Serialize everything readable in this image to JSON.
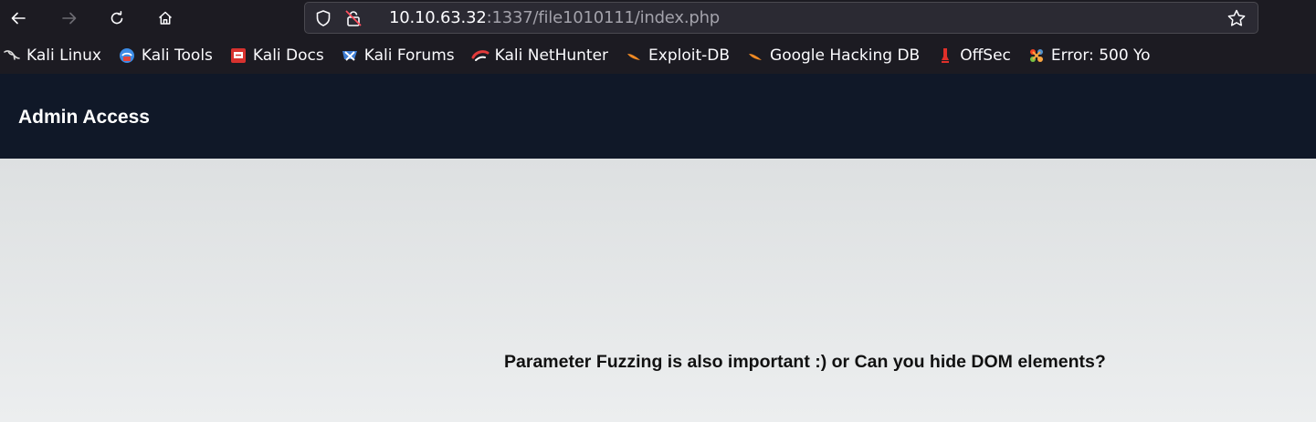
{
  "browser": {
    "url_host": "10.10.63.32",
    "url_rest": ":1337/file1010111/index.php",
    "icons": [
      "back-icon",
      "forward-icon",
      "reload-icon",
      "home-icon",
      "shield-icon",
      "lock-icon",
      "star-icon"
    ]
  },
  "bookmarks": [
    {
      "label": "Kali Linux",
      "icon": "kali-dragon-icon"
    },
    {
      "label": "Kali Tools",
      "icon": "kali-tools-icon"
    },
    {
      "label": "Kali Docs",
      "icon": "kali-docs-icon"
    },
    {
      "label": "Kali Forums",
      "icon": "kali-forums-icon"
    },
    {
      "label": "Kali NetHunter",
      "icon": "kali-nethunter-icon"
    },
    {
      "label": "Exploit-DB",
      "icon": "exploit-db-icon"
    },
    {
      "label": "Google Hacking DB",
      "icon": "ghdb-icon"
    },
    {
      "label": "OffSec",
      "icon": "offsec-icon"
    },
    {
      "label": "Error: 500 Yo",
      "icon": "joomla-icon"
    }
  ],
  "page": {
    "title": "Admin Access",
    "hint": "Parameter Fuzzing is also important :) or Can you hide DOM elements?"
  },
  "colors": {
    "toolbar_bg": "#1c1b22",
    "header_bg": "#101828",
    "content_bg": "#e6e8e9"
  }
}
